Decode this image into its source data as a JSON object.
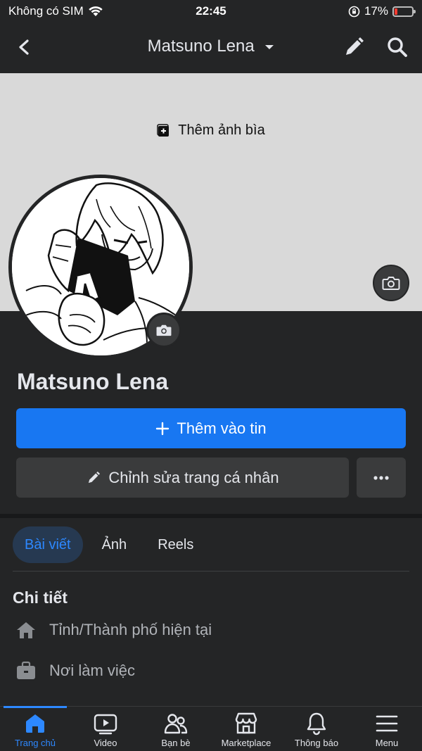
{
  "status_bar": {
    "carrier": "Không có SIM",
    "time": "22:45",
    "battery": "17%",
    "battery_level": 0.17
  },
  "header": {
    "title": "Matsuno Lena"
  },
  "cover": {
    "add_cover_label": "Thêm ảnh bìa"
  },
  "profile": {
    "name": "Matsuno Lena",
    "add_story_label": "Thêm vào tin",
    "edit_profile_label": "Chỉnh sửa trang cá nhân"
  },
  "tabs": [
    {
      "label": "Bài viết",
      "active": true
    },
    {
      "label": "Ảnh",
      "active": false
    },
    {
      "label": "Reels",
      "active": false
    }
  ],
  "details": {
    "title": "Chi tiết",
    "items": [
      {
        "label": "Tỉnh/Thành phố hiện tại",
        "icon": "home-icon"
      },
      {
        "label": "Nơi làm việc",
        "icon": "briefcase-icon"
      }
    ]
  },
  "bottom_nav": [
    {
      "label": "Trang chủ",
      "icon": "home-icon",
      "active": true
    },
    {
      "label": "Video",
      "icon": "video-icon",
      "active": false
    },
    {
      "label": "Bạn bè",
      "icon": "friends-icon",
      "active": false
    },
    {
      "label": "Marketplace",
      "icon": "marketplace-icon",
      "active": false
    },
    {
      "label": "Thông báo",
      "icon": "bell-icon",
      "active": false
    },
    {
      "label": "Menu",
      "icon": "menu-icon",
      "active": false
    }
  ],
  "colors": {
    "background": "#242526",
    "accent": "#1877f2",
    "active_tab": "#2d88ff"
  }
}
